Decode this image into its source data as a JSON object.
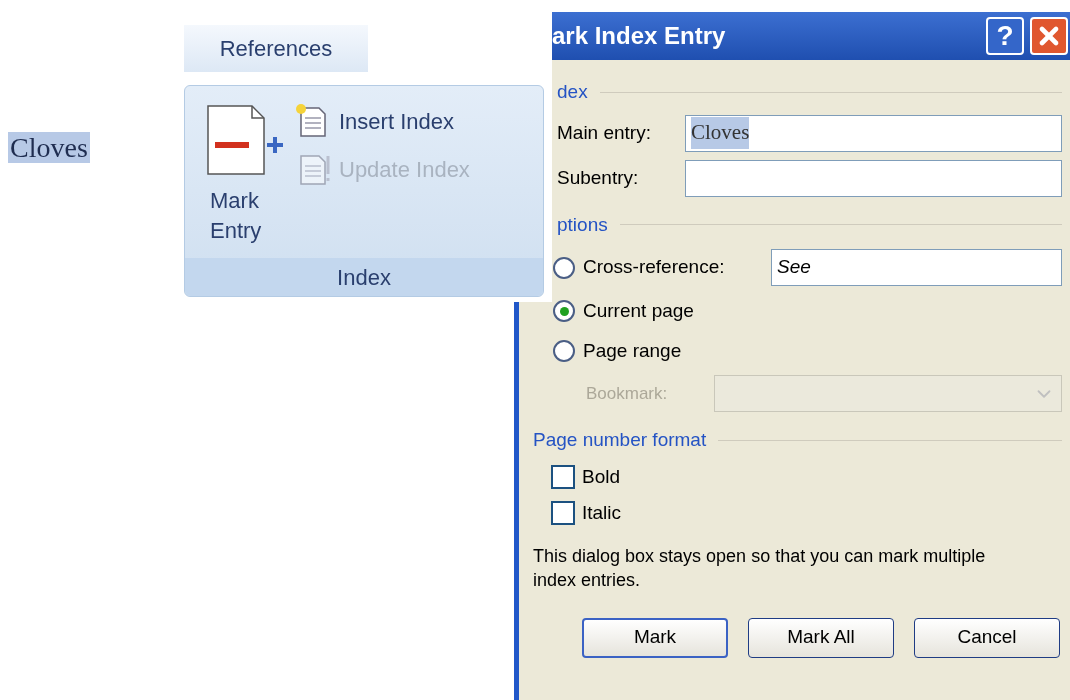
{
  "document": {
    "selected_text": "Cloves"
  },
  "ribbon": {
    "tab": "References",
    "mark_entry": "Mark Entry",
    "commands": [
      {
        "label": "Insert Index",
        "disabled": false
      },
      {
        "label": "Update Index",
        "disabled": true
      }
    ],
    "group": "Index"
  },
  "dialog": {
    "title": "ark Index Entry",
    "help_button": "?",
    "index_section": "dex",
    "fields": [
      {
        "label": "Main entry:",
        "value": "Cloves"
      },
      {
        "label": "Subentry:"
      }
    ],
    "options_section": "ptions",
    "options": [
      {
        "kind": "field",
        "label": "Cross-reference:",
        "selected": false,
        "value": "See"
      },
      {
        "kind": "plain",
        "label": "Current page",
        "selected": true
      },
      {
        "kind": "plain",
        "label": "Page range",
        "selected": false
      }
    ],
    "bookmark": {
      "label": "Bookmark:",
      "disabled": true
    },
    "format_section": "Page number format",
    "format": [
      {
        "label": "Bold",
        "checked": false
      },
      {
        "label": "Italic",
        "checked": false
      }
    ],
    "note": "This dialog box stays open so that you can mark multiple index entries.",
    "buttons": [
      "Mark",
      "Mark All",
      "Cancel"
    ]
  }
}
